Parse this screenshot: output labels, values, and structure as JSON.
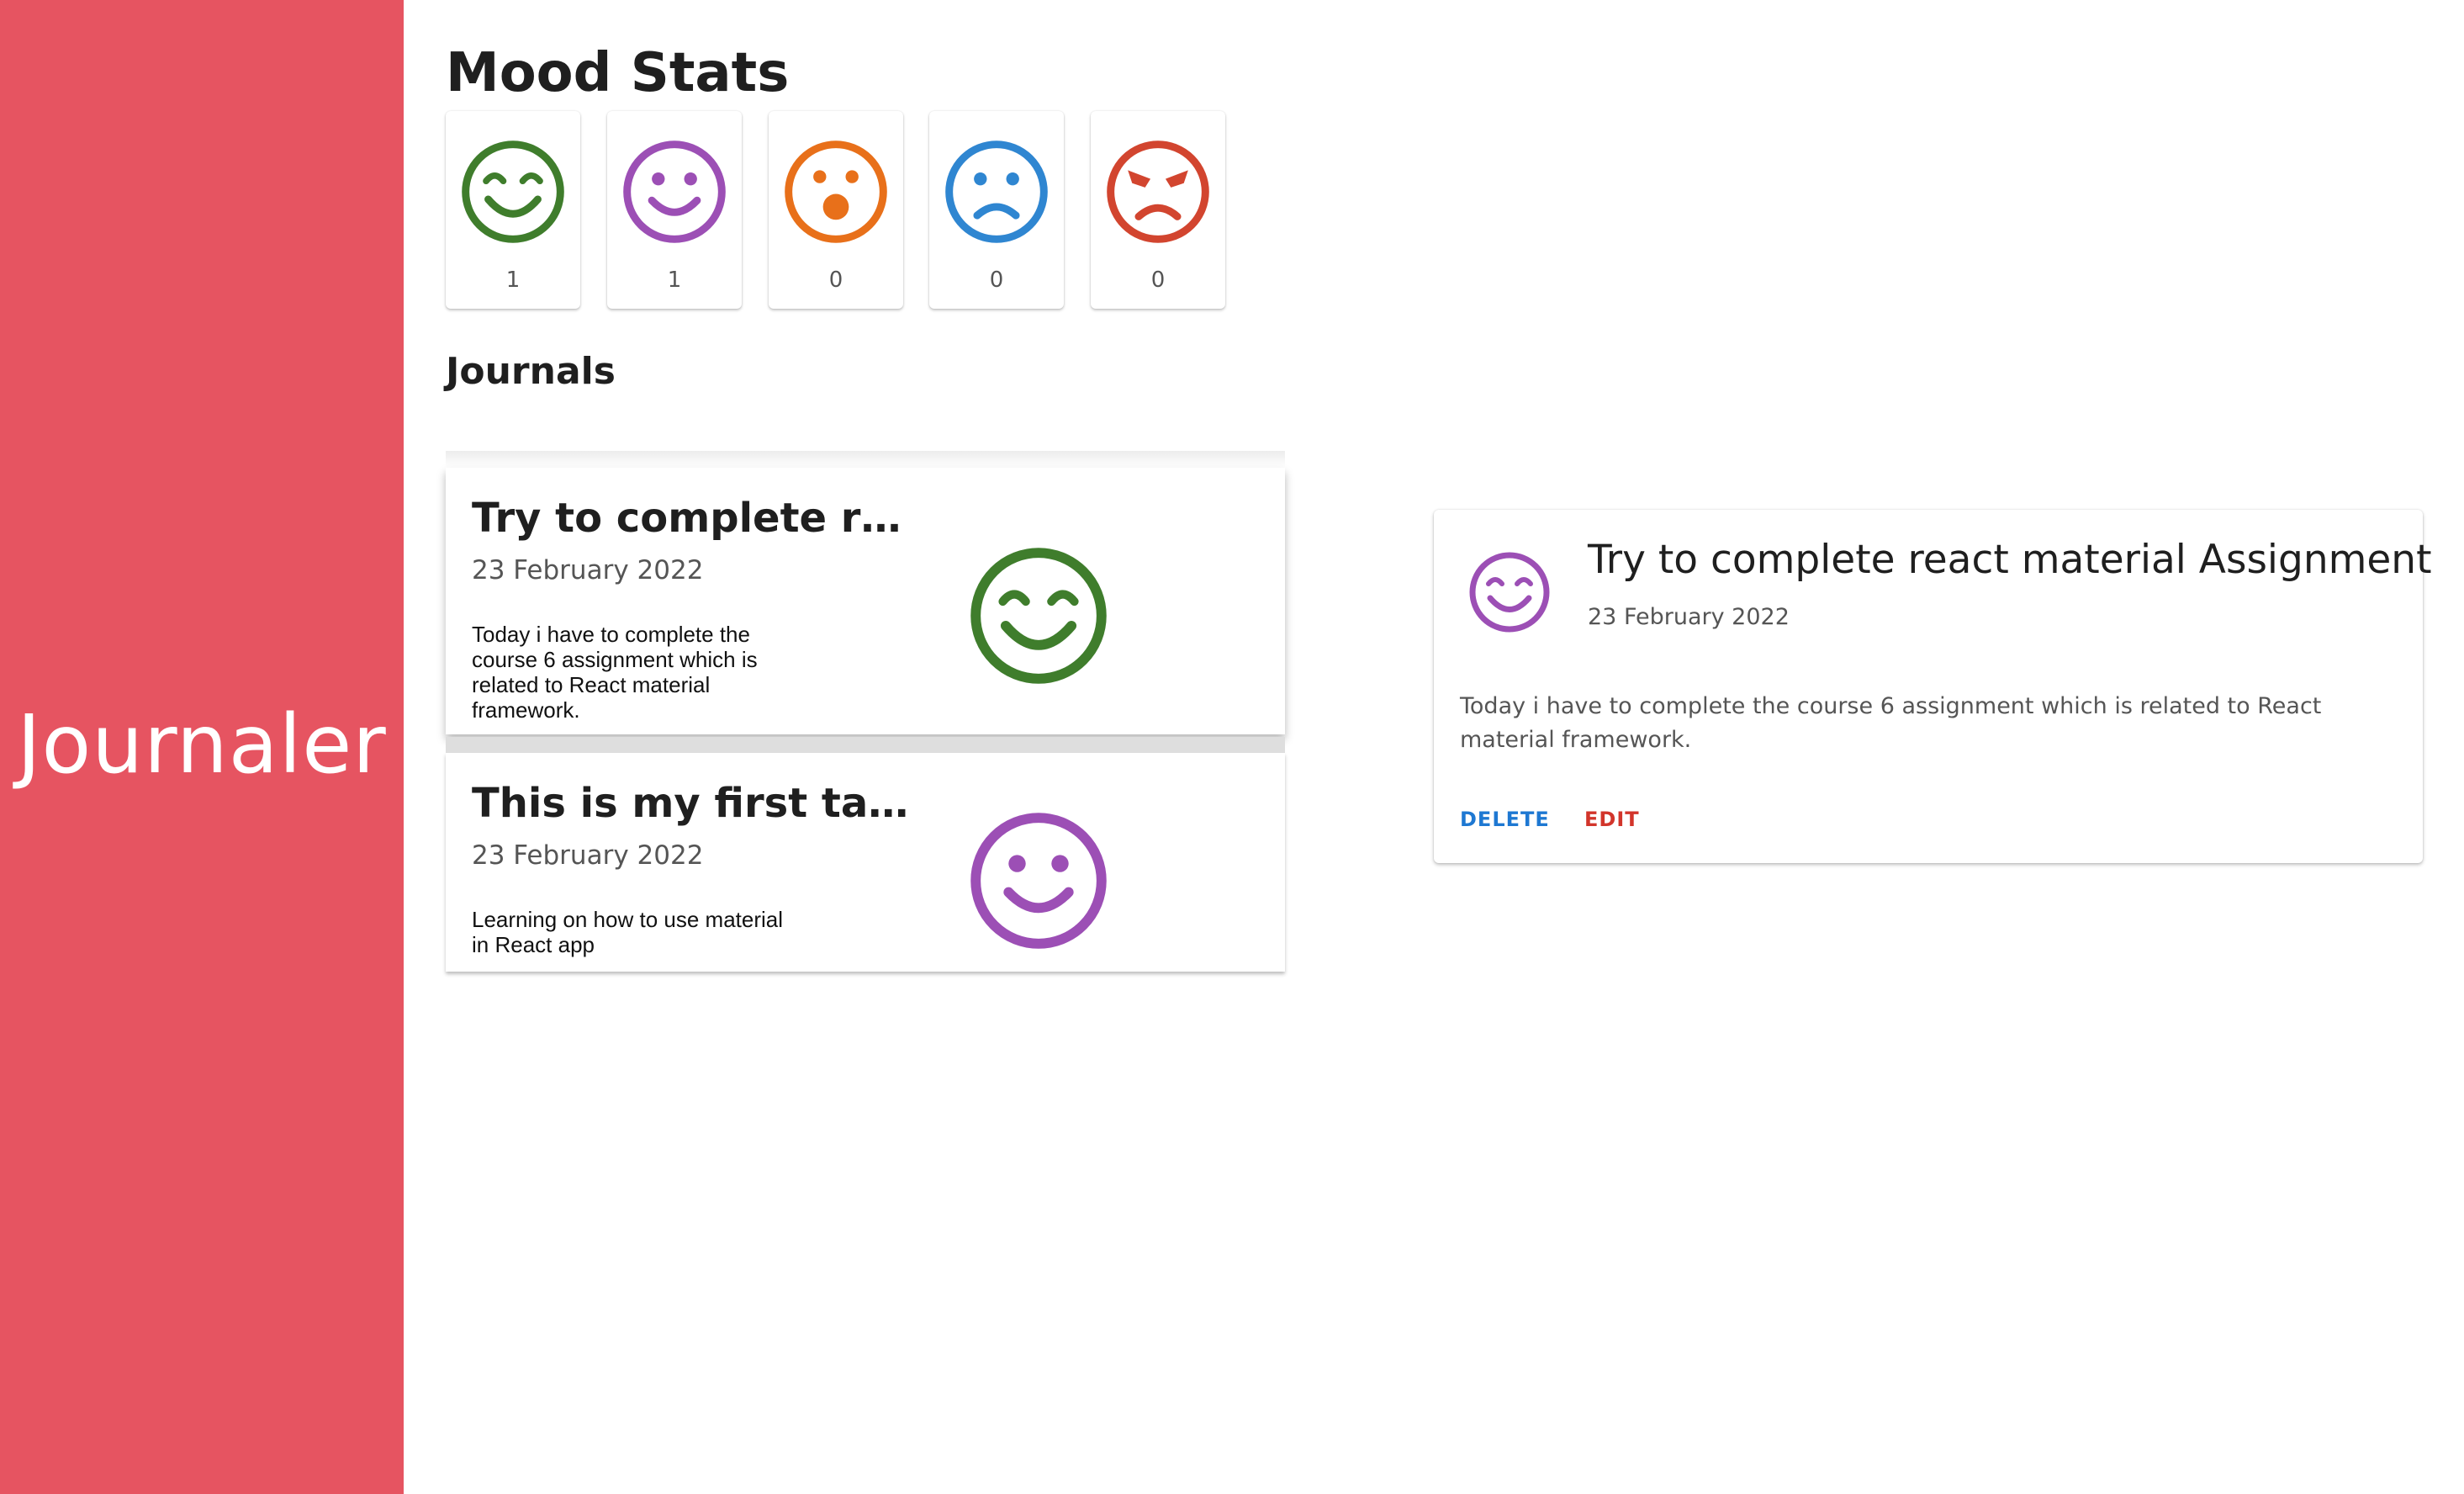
{
  "sidebar": {
    "brand": "Journaler",
    "color": "#e65461"
  },
  "mood_stats": {
    "title": "Mood Stats",
    "items": [
      {
        "icon": "grin-smile-icon",
        "color": "#3f7d2c",
        "count": "1"
      },
      {
        "icon": "smile-icon",
        "color": "#9c4fb5",
        "count": "1"
      },
      {
        "icon": "surprised-icon",
        "color": "#e8701a",
        "count": "0"
      },
      {
        "icon": "sad-icon",
        "color": "#2f86d1",
        "count": "0"
      },
      {
        "icon": "angry-icon",
        "color": "#d2452f",
        "count": "0"
      }
    ]
  },
  "journals": {
    "title": "Journals",
    "items": [
      {
        "title": "Try to complete react material Assignment",
        "date": "23 February 2022",
        "body": "Today i have to complete the course 6 assignment which is related to React material framework.",
        "mood_icon": "grin-smile-icon",
        "mood_color": "#3f7d2c"
      },
      {
        "title": "This is my first task for the React app",
        "date": "23 February 2022",
        "body": "Learning on how to use material in React app",
        "mood_icon": "smile-icon",
        "mood_color": "#9c4fb5"
      }
    ]
  },
  "detail": {
    "avatar_icon": "grin-smile-icon",
    "avatar_color": "#9c4fb5",
    "title": "Try to complete react material Assignment",
    "date": "23 February 2022",
    "body": "Today i have to complete the course 6 assignment which is related to React material framework.",
    "delete_label": "DELETE",
    "edit_label": "EDIT",
    "delete_color": "#1e78d2",
    "edit_color": "#d2352b"
  }
}
